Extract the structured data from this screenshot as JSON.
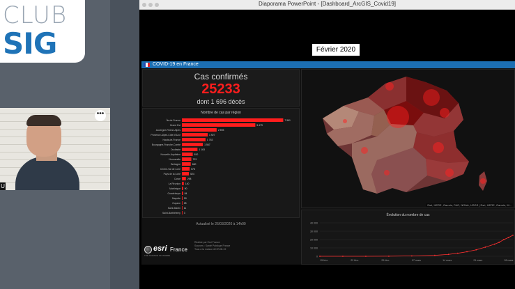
{
  "logo": {
    "line1": "CLUB",
    "line2": "SIG"
  },
  "webcam": {
    "more_label": "•••",
    "name_tag": "U"
  },
  "window": {
    "title": "Diaporama PowerPoint - [Dashboard_ArcGIS_Covid19]"
  },
  "slide": {
    "date_label": "Février 2020"
  },
  "dashboard": {
    "title": "COVID-19 en France",
    "cases_label": "Cas confirmés",
    "cases_value": "25233",
    "deaths_label": "dont 1 696 décès",
    "bar_chart_title": "Nombre de cas par région",
    "update_label": "Actualisé le 26/03/2020 à 14h00",
    "map_attribution": "Esri, HERE, Garmin, FAO, NOAA, USGS | Esri, HERE, Garmin, M...",
    "evolution_title": "Évolution du nombre de cas",
    "esri": {
      "word": "esri",
      "country": "France",
      "tagline": "THE SCIENCE OF WHERE"
    },
    "credits": [
      "Réalisé par Esri France",
      "Sources : Santé Publique France",
      "Tous à la maison #COVID-19"
    ]
  },
  "colors": {
    "accent": "#1c6fb3",
    "bars": "#ff1d1d",
    "cases": "#ff1d1d",
    "background": "#000000"
  },
  "chart_data": [
    {
      "type": "bar",
      "orientation": "horizontal",
      "title": "Nombre de cas par région",
      "categories": [
        "Île-de-France",
        "Grand Est",
        "Auvergne-Rhône-Alpes",
        "Provence-Alpes-Côte d'Azur",
        "Hauts-de-France",
        "Bourgogne-Franche-Comté",
        "Occitanie",
        "Nouvelle-Aquitaine",
        "Normandie",
        "Bretagne",
        "Centre-Val de Loire",
        "Pays de la Loire",
        "Corse",
        "La Réunion",
        "Martinique",
        "Guadeloupe",
        "Mayotte",
        "Guyane",
        "Saint-Martin",
        "Saint-Barthélemy"
      ],
      "values": [
        7561,
        5479,
        2593,
        1927,
        1763,
        1567,
        1163,
        810,
        703,
        660,
        578,
        524,
        298,
        140,
        90,
        84,
        50,
        28,
        11,
        3
      ],
      "value_labels": [
        "7 561",
        "5 479",
        "2 593",
        "1 927",
        "1 763",
        "1 567",
        "1 163",
        "810",
        "703",
        "660",
        "578",
        "524",
        "298",
        "140",
        "90",
        "84",
        "50",
        "28",
        "11",
        "3"
      ],
      "xlim": [
        0,
        7800
      ]
    },
    {
      "type": "line",
      "title": "Évolution du nombre de cas",
      "categories": [
        "15 févr.",
        "22 févr.",
        "29 févr.",
        "07 mars",
        "14 mars",
        "21 mars",
        "28 mars"
      ],
      "y_tick_labels": [
        "40 000",
        "30 000",
        "20 000",
        "10 000",
        "0"
      ],
      "x": [
        0,
        5,
        10,
        15,
        20,
        25,
        28,
        30,
        32,
        34,
        36,
        38,
        39,
        40,
        41,
        42
      ],
      "values": [
        12,
        12,
        18,
        100,
        400,
        1100,
        2300,
        3600,
        5400,
        7700,
        10900,
        14500,
        16700,
        19900,
        22300,
        25233
      ],
      "ylim": [
        0,
        40000
      ]
    }
  ]
}
